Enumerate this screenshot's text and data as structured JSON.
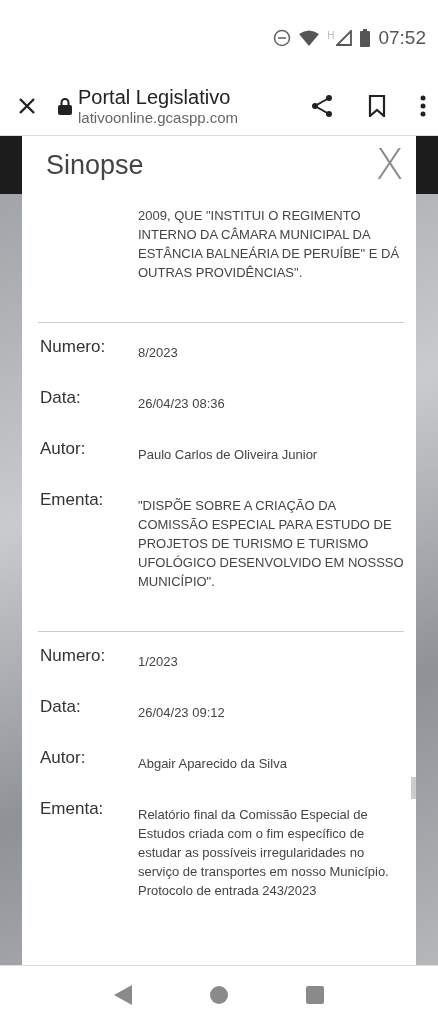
{
  "status_bar": {
    "time": "07:52",
    "network": "H"
  },
  "browser": {
    "title": "Portal Legislativo",
    "url": "lativoonline.gcaspp.com"
  },
  "modal": {
    "title": "Sinopse",
    "close": "X",
    "records": [
      {
        "fields": [
          {
            "value": "2009, QUE \"INSTITUI O REGIMENTO INTERNO DA CÂMARA MUNICIPAL DA ESTÂNCIA BALNEÁRIA DE PERUÍBE\" E DÁ OUTRAS PROVIDÊNCIAS\"."
          }
        ]
      },
      {
        "fields": [
          {
            "label": "Numero:",
            "value": "8/2023"
          },
          {
            "label": "Data:",
            "value": "26/04/23 08:36"
          },
          {
            "label": "Autor:",
            "value": "Paulo Carlos de Oliveira Junior"
          },
          {
            "label": "Ementa:",
            "value": "\"DISPÕE SOBRE A CRIAÇÃO DA COMISSÃO ESPECIAL PARA ESTUDO DE PROJETOS DE TURISMO E TURISMO UFOLÓGICO DESENVOLVIDO EM NOSSSO MUNICÍPIO\"."
          }
        ]
      },
      {
        "fields": [
          {
            "label": "Numero:",
            "value": "1/2023"
          },
          {
            "label": "Data:",
            "value": "26/04/23 09:12"
          },
          {
            "label": "Autor:",
            "value": "Abgair Aparecido da Silva"
          },
          {
            "label": "Ementa:",
            "value": "Relatório final da Comissão Especial de Estudos criada com o fim específico de estudar as possíveis irregularidades no serviço de transportes em nosso Município. Protocolo de entrada 243/2023"
          }
        ]
      }
    ]
  }
}
